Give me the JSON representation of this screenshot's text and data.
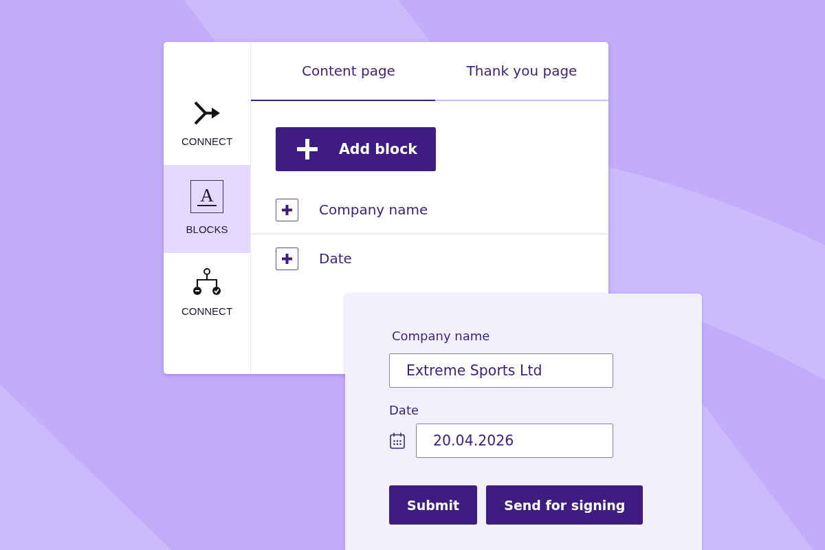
{
  "sidebar": {
    "items": [
      {
        "kind": "merge",
        "label": "CONNECT",
        "selected": false
      },
      {
        "kind": "letter",
        "glyph": "A",
        "label": "BLOCKS",
        "selected": true
      },
      {
        "kind": "tree",
        "label": "CONNECT",
        "selected": false
      }
    ]
  },
  "tabs": [
    {
      "label": "Content page",
      "selected": true
    },
    {
      "label": "Thank you page",
      "selected": false
    }
  ],
  "add_button": "Add block",
  "blocks": [
    "Company name",
    "Date"
  ],
  "form": {
    "fields": [
      {
        "kind": "text",
        "label": "Company name",
        "value": "Extreme Sports Ltd"
      },
      {
        "kind": "date",
        "label": "Date",
        "value": "20.04.2026"
      }
    ],
    "buttons": [
      "Submit",
      "Send for signing"
    ]
  }
}
